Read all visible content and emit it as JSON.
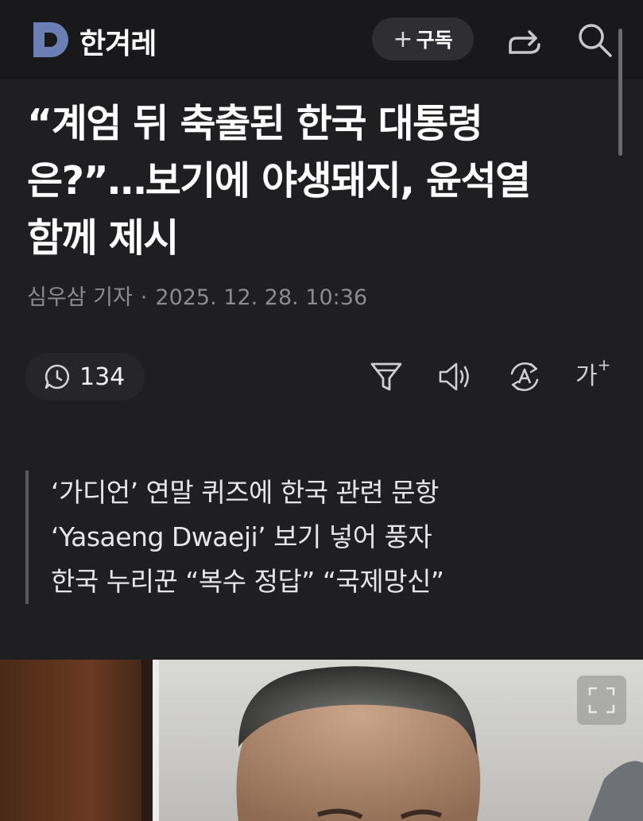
{
  "header": {
    "brand": "한겨레",
    "subscribe_plus": "+",
    "subscribe_label": "구독"
  },
  "article": {
    "title_line1": "“계엄 뒤 축출된 한국 대통령",
    "title_line2": "은?”…보기에 야생돼지, 윤석열",
    "title_line3": "함께 제시",
    "author": "심우삼 기자",
    "separator": "·",
    "datetime": "2025. 12. 28. 10:36"
  },
  "toolbar": {
    "comment_count": "134",
    "font_size_label": "가",
    "font_size_plus": "+"
  },
  "summary": {
    "lines": [
      "‘가디언’ 연말 퀴즈에 한국 관련 문항",
      "‘Yasaeng Dwaeji’ 보기 넣어 풍자",
      "한국 누리꾼 “복수 정답” “국제망신”"
    ]
  },
  "icons": {
    "logo": "hankyoreh-logo-icon",
    "share": "share-icon",
    "search": "search-icon",
    "comment": "comment-icon",
    "filter": "filter-icon",
    "audio": "speaker-icon",
    "translate": "auto-translate-icon",
    "expand": "expand-icon"
  },
  "colors": {
    "background": "#1f1f21",
    "header_bg": "#19191b",
    "logo": "#6b7fb5",
    "title": "#ffffff",
    "meta": "#8c8c90"
  }
}
